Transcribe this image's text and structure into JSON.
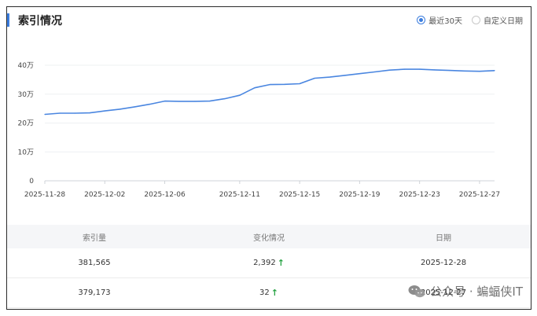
{
  "header": {
    "title": "索引情况",
    "range_options": [
      {
        "label": "最近30天",
        "selected": true
      },
      {
        "label": "自定义日期",
        "selected": false
      }
    ]
  },
  "colors": {
    "accent": "#3b7dde",
    "line": "#4a86e0",
    "up": "#27a344"
  },
  "chart_data": {
    "type": "line",
    "title": "",
    "xlabel": "",
    "ylabel": "",
    "ylim": [
      0,
      400000
    ],
    "y_ticks": [
      {
        "value": 0,
        "label": "0"
      },
      {
        "value": 100000,
        "label": "10万"
      },
      {
        "value": 200000,
        "label": "20万"
      },
      {
        "value": 300000,
        "label": "30万"
      },
      {
        "value": 400000,
        "label": "40万"
      }
    ],
    "x_ticks": [
      "2025-11-28",
      "2025-12-02",
      "2025-12-06",
      "2025-12-11",
      "2025-12-15",
      "2025-12-19",
      "2025-12-23",
      "2025-12-27"
    ],
    "x": [
      "2025-11-28",
      "2025-11-29",
      "2025-11-30",
      "2025-12-01",
      "2025-12-02",
      "2025-12-03",
      "2025-12-04",
      "2025-12-05",
      "2025-12-06",
      "2025-12-07",
      "2025-12-08",
      "2025-12-09",
      "2025-12-10",
      "2025-12-11",
      "2025-12-12",
      "2025-12-13",
      "2025-12-14",
      "2025-12-15",
      "2025-12-16",
      "2025-12-17",
      "2025-12-18",
      "2025-12-19",
      "2025-12-20",
      "2025-12-21",
      "2025-12-22",
      "2025-12-23",
      "2025-12-24",
      "2025-12-25",
      "2025-12-26",
      "2025-12-27",
      "2025-12-28"
    ],
    "grid": true,
    "series": [
      {
        "name": "",
        "values": [
          230000,
          234000,
          234000,
          235000,
          242000,
          248000,
          256000,
          265000,
          276000,
          275000,
          275000,
          276000,
          284000,
          296000,
          322000,
          333000,
          334000,
          336000,
          355000,
          359000,
          365000,
          371000,
          377000,
          383000,
          386000,
          386000,
          384000,
          382000,
          380000,
          379173,
          381565
        ]
      }
    ]
  },
  "table": {
    "headers": [
      "索引量",
      "变化情况",
      "日期"
    ],
    "rows": [
      {
        "count": "381,565",
        "change": "2,392",
        "date": "2025-12-28"
      },
      {
        "count": "379,173",
        "change": "32",
        "date": "2025-12-27"
      }
    ]
  },
  "watermark": {
    "icon": "wechat-icon",
    "text": "公众号 · 蝙蝠侠IT"
  }
}
